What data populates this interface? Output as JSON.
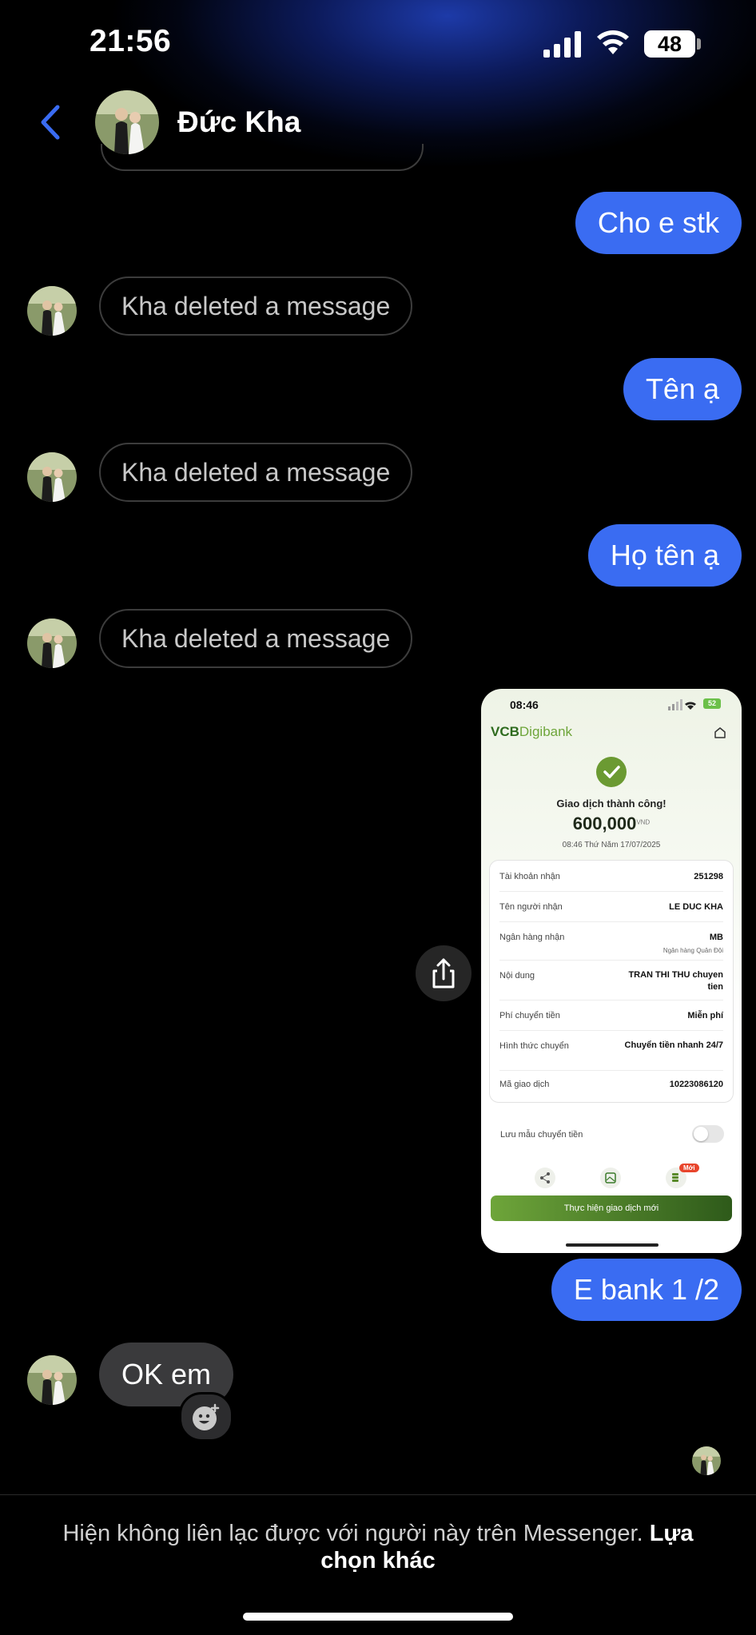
{
  "status_bar": {
    "time": "21:56",
    "battery": "48"
  },
  "header": {
    "contact_name": "Đức Kha"
  },
  "messages": {
    "out_1": "Cho e stk",
    "deleted": "Kha deleted a message",
    "out_2": "Tên ạ",
    "out_3": "Họ tên ạ",
    "out_4": "E bank 1 /2",
    "in_1": "OK em"
  },
  "receipt": {
    "time": "08:46",
    "battery": "52",
    "brand_vcb": "VCB",
    "brand_digibank": "Digibank",
    "success": "Giao dịch thành công!",
    "amount": "600,000",
    "currency": "VND",
    "datetime": "08:46 Thứ Năm 17/07/2025",
    "rows": [
      {
        "label": "Tài khoản nhận",
        "value": "251298"
      },
      {
        "label": "Tên người nhận",
        "value": "LE DUC KHA"
      },
      {
        "label": "Ngân hàng nhận",
        "value": "MB",
        "sub": "Ngân hàng Quân Đội"
      },
      {
        "label": "Nội dung",
        "value": "TRAN THI THU chuyen tien"
      },
      {
        "label": "Phí chuyển tiền",
        "value": "Miễn phí"
      },
      {
        "label": "Hình thức chuyển",
        "value": "Chuyển tiền nhanh 24/7"
      },
      {
        "label": "Mã giao dịch",
        "value": "10223086120"
      }
    ],
    "save_template": "Lưu mẫu chuyển tiền",
    "new_badge": "Mới",
    "new_transaction": "Thực hiện giao dịch mới"
  },
  "footer": {
    "notice": "Hiện không liên lạc được với người này trên Messenger.",
    "link": "Lựa chọn khác"
  },
  "colors": {
    "accent": "#3a6cf2",
    "vcb_green": "#5b8a2c"
  }
}
